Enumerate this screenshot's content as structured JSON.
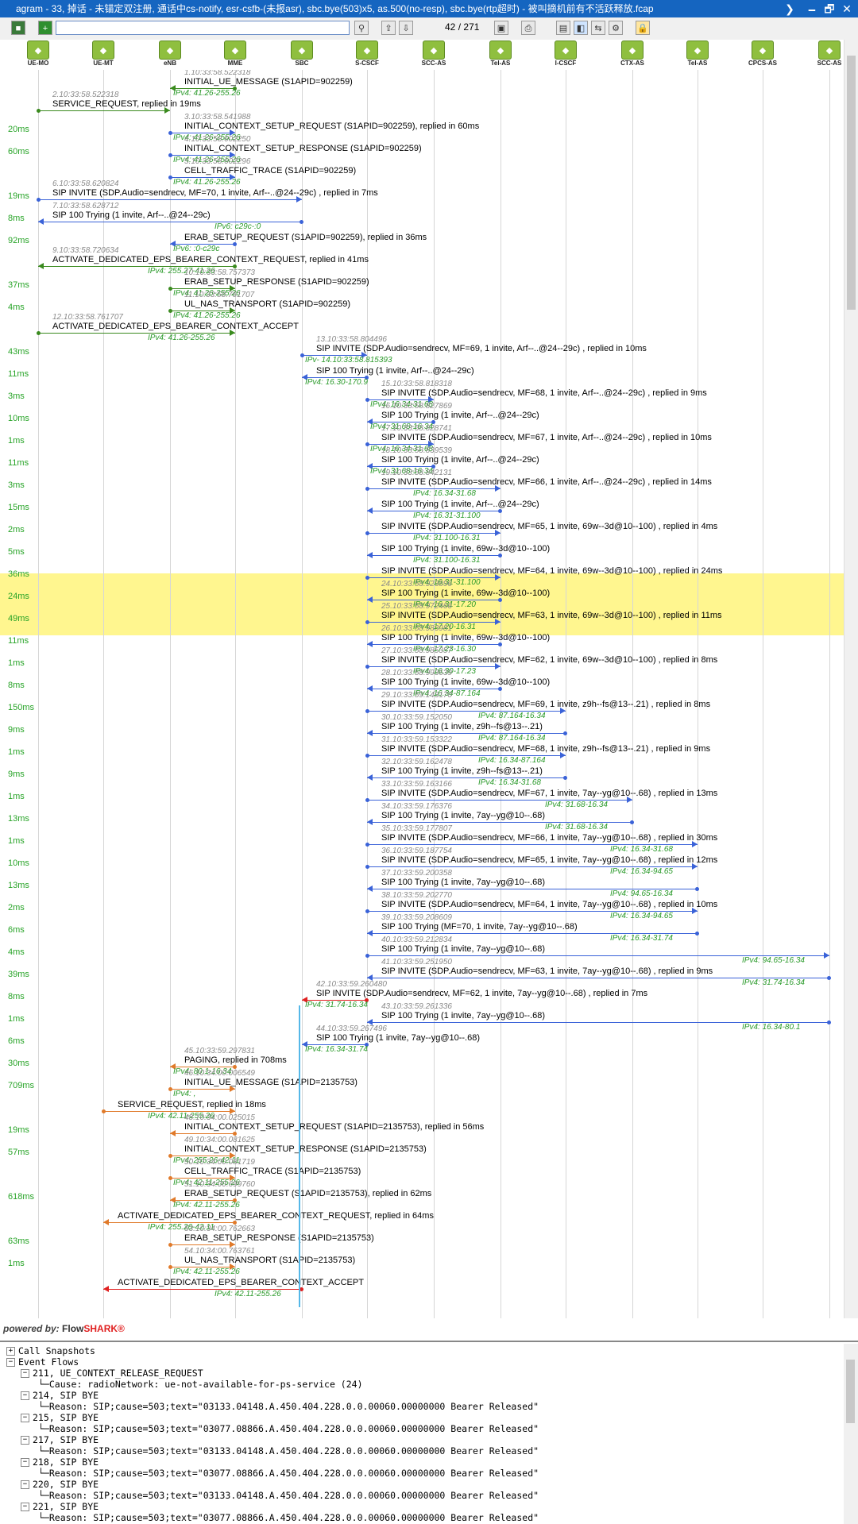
{
  "window": {
    "title": "agram - 33, 掉话 - 未锚定双注册, 通话中cs-notify, esr-csfb-(未报asr), sbc.bye(503)x5, as.500(no-resp), sbc.bye(rtp超时) - 被叫摘机前有不活跃释放.fcap",
    "controls": [
      "❯",
      "🗕",
      "🗗",
      "✕"
    ]
  },
  "toolbar": {
    "filter_value": "",
    "page_current": "42",
    "page_total": "271",
    "page_sep": "/"
  },
  "nodes": [
    "UE-MO",
    "UE-MT",
    "eNB",
    "MME",
    "SBC",
    "S-CSCF",
    "SCC-AS",
    "Tel-AS",
    "I-CSCF",
    "CTX-AS",
    "Tel-AS",
    "CPCS-AS",
    "SCC-AS"
  ],
  "messages": [
    {
      "ts": "1.10:33:58.522318",
      "text": "INITIAL_UE_MESSAGE (S1APID=902259)",
      "ip": "IPv4: 41.26-255.26",
      "delta": ""
    },
    {
      "ts": "2.10:33:58.522318",
      "text": "SERVICE_REQUEST, replied in 19ms",
      "ip": "",
      "delta": ""
    },
    {
      "ts": "3.10:33:58.541988",
      "text": "INITIAL_CONTEXT_SETUP_REQUEST (S1APID=902259), replied in 60ms",
      "ip": "IPv4: 41.26-255.26",
      "delta": "20ms"
    },
    {
      "ts": "4.10:33:58.602250",
      "text": "INITIAL_CONTEXT_SETUP_RESPONSE (S1APID=902259)",
      "ip": "IPv4: 41.26-255.26",
      "delta": "60ms"
    },
    {
      "ts": "5.10:33:58.602296",
      "text": "CELL_TRAFFIC_TRACE (S1APID=902259)",
      "ip": "IPv4: 41.26-255.26",
      "delta": ""
    },
    {
      "ts": "6.10:33:58.620824",
      "text": "SIP INVITE (SDP.Audio=sendrecv, MF=70, 1 invite, Arf--..@24--29c) , replied in 7ms",
      "ip": "",
      "delta": "19ms"
    },
    {
      "ts": "7.10:33:58.628712",
      "text": "SIP 100 Trying (1 invite, Arf--..@24--29c)",
      "ip": "IPv6: c29c-:0",
      "delta": "8ms"
    },
    {
      "ts": "",
      "text": "ERAB_SETUP_REQUEST (S1APID=902259), replied in 36ms",
      "ip": "IPv6: :0-c29c",
      "delta": "92ms"
    },
    {
      "ts": "9.10:33:58.720634",
      "text": "ACTIVATE_DEDICATED_EPS_BEARER_CONTEXT_REQUEST, replied in 41ms",
      "ip": "IPv4: 255.27-41.26",
      "delta": ""
    },
    {
      "ts": "10.10:33:58.757373",
      "text": "ERAB_SETUP_RESPONSE (S1APID=902259)",
      "ip": "IPv4: 41.26-255.26",
      "delta": "37ms"
    },
    {
      "ts": "11.10:33:58.761707",
      "text": "UL_NAS_TRANSPORT (S1APID=902259)",
      "ip": "IPv4: 41.26-255.26",
      "delta": "4ms"
    },
    {
      "ts": "12.10:33:58.761707",
      "text": "ACTIVATE_DEDICATED_EPS_BEARER_CONTEXT_ACCEPT",
      "ip": "IPv4: 41.26-255.26",
      "delta": ""
    },
    {
      "ts": "13.10:33:58.804496",
      "text": "SIP INVITE (SDP.Audio=sendrecv, MF=69, 1 invite, Arf--..@24--29c) , replied in 10ms",
      "ip": "IPv- 14.10:33:58.815393",
      "delta": "43ms"
    },
    {
      "ts": "",
      "text": "SIP 100 Trying (1 invite, Arf--..@24--29c)",
      "ip": "IPv4: 16.30-170.9",
      "delta": "11ms"
    },
    {
      "ts": "15.10:33:58.818318",
      "text": "SIP INVITE (SDP.Audio=sendrecv, MF=68, 1 invite, Arf--..@24--29c) , replied in 9ms",
      "ip": "IPv4: 16.34-31.68",
      "delta": "3ms"
    },
    {
      "ts": "16.10:33:58.827869",
      "text": "SIP 100 Trying (1 invite, Arf--..@24--29c)",
      "ip": "IPv4: 31.68-16.34",
      "delta": "10ms"
    },
    {
      "ts": "17.10:33:58.828741",
      "text": "SIP INVITE (SDP.Audio=sendrecv, MF=67, 1 invite, Arf--..@24--29c) , replied in 10ms",
      "ip": "IPv4: 16.34-31.68",
      "delta": "1ms"
    },
    {
      "ts": "18.10:33:58.839539",
      "text": "SIP 100 Trying (1 invite, Arf--..@24--29c)",
      "ip": "IPv4: 31.68-16.34",
      "delta": "11ms"
    },
    {
      "ts": "19.10:33:58.842131",
      "text": "SIP INVITE (SDP.Audio=sendrecv, MF=66, 1 invite, Arf--..@24--29c) , replied in 14ms",
      "ip": "IPv4: 16.34-31.68",
      "delta": "3ms"
    },
    {
      "ts": "",
      "text": "SIP 100 Trying (1 invite, Arf--..@24--29c)",
      "ip": "IPv4: 16.31-31.100",
      "delta": "15ms"
    },
    {
      "ts": "",
      "text": "SIP INVITE (SDP.Audio=sendrecv, MF=65, 1 invite, 69w--3d@10--100) , replied in 4ms",
      "ip": "IPv4: 31.100-16.31",
      "delta": "2ms"
    },
    {
      "ts": "",
      "text": "SIP 100 Trying (1 invite, 69w--3d@10--100)",
      "ip": "IPv4: 31.100-16.31",
      "delta": "5ms"
    },
    {
      "ts": "",
      "text": "SIP INVITE (SDP.Audio=sendrecv, MF=64, 1 invite, 69w--3d@10--100) , replied in 24ms",
      "ip": "IPv4: 16.31-31.100",
      "delta": "36ms"
    },
    {
      "ts": "24.10:33:58.923896",
      "text": "SIP 100 Trying (1 invite, 69w--3d@10--100)",
      "ip": "IPv4: 16.31-17.20",
      "delta": "24ms"
    },
    {
      "ts": "25.10:33:58.972466",
      "text": "SIP INVITE (SDP.Audio=sendrecv, MF=63, 1 invite, 69w--3d@10--100) , replied in 11ms",
      "ip": "IPv4: 17.20-16.31",
      "delta": "49ms"
    },
    {
      "ts": "26.10:33:58.983981",
      "text": "SIP 100 Trying (1 invite, 69w--3d@10--100)",
      "ip": "IPv4: 17.23-16.30",
      "delta": "11ms"
    },
    {
      "ts": "27.10:33:58.985357",
      "text": "SIP INVITE (SDP.Audio=sendrecv, MF=62, 1 invite, 69w--3d@10--100) , replied in 8ms",
      "ip": "IPv4: 16.30-17.23",
      "delta": "1ms"
    },
    {
      "ts": "28.10:33:58.993639",
      "text": "SIP 100 Trying (1 invite, 69w--3d@10--100)",
      "ip": "IPv4: 16.34-87.164",
      "delta": "8ms"
    },
    {
      "ts": "29.10:33:59.143170",
      "text": "SIP INVITE (SDP.Audio=sendrecv, MF=69, 1 invite, z9h--fs@13--.21) , replied in 8ms",
      "ip": "IPv4: 87.164-16.34",
      "delta": "150ms"
    },
    {
      "ts": "30.10:33:59.152050",
      "text": "SIP 100 Trying (1 invite, z9h--fs@13--.21)",
      "ip": "IPv4: 87.164-16.34",
      "delta": "9ms"
    },
    {
      "ts": "31.10:33:59.153322",
      "text": "SIP INVITE (SDP.Audio=sendrecv, MF=68, 1 invite, z9h--fs@13--.21) , replied in 9ms",
      "ip": "IPv4: 16.34-87.164",
      "delta": "1ms"
    },
    {
      "ts": "32.10:33:59.162478",
      "text": "SIP 100 Trying (1 invite, z9h--fs@13--.21)",
      "ip": "IPv4: 16.34-31.68",
      "delta": "9ms"
    },
    {
      "ts": "33.10:33:59.163166",
      "text": "SIP INVITE (SDP.Audio=sendrecv, MF=67, 1 invite, 7ay--yg@10--.68) , replied in 13ms",
      "ip": "IPv4: 31.68-16.34",
      "delta": "1ms"
    },
    {
      "ts": "34.10:33:59.176376",
      "text": "SIP 100 Trying (1 invite, 7ay--yg@10--.68)",
      "ip": "IPv4: 31.68-16.34",
      "delta": "13ms"
    },
    {
      "ts": "35.10:33:59.177807",
      "text": "SIP INVITE (SDP.Audio=sendrecv, MF=66, 1 invite, 7ay--yg@10--.68) , replied in 30ms",
      "ip": "IPv4: 16.34-31.68",
      "delta": "1ms"
    },
    {
      "ts": "36.10:33:59.187754",
      "text": "SIP INVITE (SDP.Audio=sendrecv, MF=65, 1 invite, 7ay--yg@10--.68) , replied in 12ms",
      "ip": "IPv4: 16.34-94.65",
      "delta": "10ms"
    },
    {
      "ts": "37.10:33:59.200358",
      "text": "SIP 100 Trying (1 invite, 7ay--yg@10--.68)",
      "ip": "IPv4: 94.65-16.34",
      "delta": "13ms"
    },
    {
      "ts": "38.10:33:59.202770",
      "text": "SIP INVITE (SDP.Audio=sendrecv, MF=64, 1 invite, 7ay--yg@10--.68) , replied in 10ms",
      "ip": "IPv4: 16.34-94.65",
      "delta": "2ms"
    },
    {
      "ts": "39.10:33:59.208609",
      "text": "SIP 100 Trying (MF=70, 1 invite, 7ay--yg@10--.68)",
      "ip": "IPv4: 16.34-31.74",
      "delta": "6ms"
    },
    {
      "ts": "40.10:33:59.212834",
      "text": "SIP 100 Trying (1 invite, 7ay--yg@10--.68)",
      "ip": "IPv4: 94.65-16.34",
      "delta": "4ms"
    },
    {
      "ts": "41.10:33:59.251950",
      "text": "SIP INVITE (SDP.Audio=sendrecv, MF=63, 1 invite, 7ay--yg@10--.68) , replied in 9ms",
      "ip": "IPv4: 31.74-16.34",
      "delta": "39ms"
    },
    {
      "ts": "42.10:33:59.260480",
      "text": "SIP INVITE (SDP.Audio=sendrecv, MF=62, 1 invite, 7ay--yg@10--.68) , replied in 7ms",
      "ip": "IPv4: 31.74-16.34",
      "delta": "8ms"
    },
    {
      "ts": "43.10:33:59.261336",
      "text": "SIP 100 Trying (1 invite, 7ay--yg@10--.68)",
      "ip": "IPv4: 16.34-80.1",
      "delta": "1ms"
    },
    {
      "ts": "44.10:33:59.267496",
      "text": "SIP 100 Trying (1 invite, 7ay--yg@10--.68)",
      "ip": "IPv4: 16.34-31.74",
      "delta": "6ms"
    },
    {
      "ts": "45.10:33:59.297831",
      "text": "PAGING, replied in 708ms",
      "ip": "IPv4: 80.1-16.34",
      "delta": "30ms"
    },
    {
      "ts": "46.10:34:00.006549",
      "text": "INITIAL_UE_MESSAGE (S1APID=2135753)",
      "ip": "IPv4: ,",
      "delta": "709ms"
    },
    {
      "ts": "",
      "text": "SERVICE_REQUEST, replied in 18ms",
      "ip": "IPv4: 42.11-255.26",
      "delta": ""
    },
    {
      "ts": "48.10:34:00.025015",
      "text": "INITIAL_CONTEXT_SETUP_REQUEST (S1APID=2135753), replied in 56ms",
      "ip": "",
      "delta": "19ms"
    },
    {
      "ts": "49.10:34:00.081625",
      "text": "INITIAL_CONTEXT_SETUP_RESPONSE (S1APID=2135753)",
      "ip": "IPv4: 255.26-42.11",
      "delta": "57ms"
    },
    {
      "ts": "50.10:34:00.081719",
      "text": "CELL_TRAFFIC_TRACE (S1APID=2135753)",
      "ip": "IPv4: 42.11-255.26",
      "delta": ""
    },
    {
      "ts": "51.10:34:00.699760",
      "text": "ERAB_SETUP_REQUEST (S1APID=2135753), replied in 62ms",
      "ip": "IPv4: 42.11-255.26",
      "delta": "618ms"
    },
    {
      "ts": "",
      "text": "ACTIVATE_DEDICATED_EPS_BEARER_CONTEXT_REQUEST, replied in 64ms",
      "ip": "IPv4: 255.26-42.11",
      "delta": ""
    },
    {
      "ts": "53.10:34:00.762663",
      "text": "ERAB_SETUP_RESPONSE (S1APID=2135753)",
      "ip": "",
      "delta": "63ms"
    },
    {
      "ts": "54.10:34:00.763761",
      "text": "UL_NAS_TRANSPORT (S1APID=2135753)",
      "ip": "IPv4: 42.11-255.26",
      "delta": "1ms"
    },
    {
      "ts": "",
      "text": "ACTIVATE_DEDICATED_EPS_BEARER_CONTEXT_ACCEPT",
      "ip": "IPv4: 42.11-255.26",
      "delta": ""
    }
  ],
  "footer": {
    "powered": "powered by:",
    "flow": "Flow",
    "shark": "SHARK®"
  },
  "tree": {
    "root1": "Call Snapshots",
    "root2": "Event Flows",
    "items": [
      {
        "head": "211, UE_CONTEXT_RELEASE_REQUEST",
        "detail": "Cause:  radioNetwork: ue-not-available-for-ps-service (24)"
      },
      {
        "head": "214, SIP BYE",
        "detail": "Reason: SIP;cause=503;text=\"03133.04148.A.450.404.228.0.0.00060.00000000 Bearer Released\""
      },
      {
        "head": "215, SIP BYE",
        "detail": "Reason: SIP;cause=503;text=\"03077.08866.A.450.404.228.0.0.00060.00000000 Bearer Released\""
      },
      {
        "head": "217, SIP BYE",
        "detail": "Reason: SIP;cause=503;text=\"03133.04148.A.450.404.228.0.0.00060.00000000 Bearer Released\""
      },
      {
        "head": "218, SIP BYE",
        "detail": "Reason: SIP;cause=503;text=\"03077.08866.A.450.404.228.0.0.00060.00000000 Bearer Released\""
      },
      {
        "head": "220, SIP BYE",
        "detail": "Reason: SIP;cause=503;text=\"03133.04148.A.450.404.228.0.0.00060.00000000 Bearer Released\""
      },
      {
        "head": "221, SIP BYE",
        "detail": "Reason: SIP;cause=503;text=\"03077.08866.A.450.404.228.0.0.00060.00000000 Bearer Released\""
      }
    ]
  },
  "colors": {
    "highlight": "#fff68f",
    "arrow_blue": "#3a62d8",
    "arrow_green": "#3a8a1e",
    "arrow_orange": "#e07a2a",
    "arrow_red": "#e02020",
    "arrow_cyan": "#55b8e8"
  }
}
